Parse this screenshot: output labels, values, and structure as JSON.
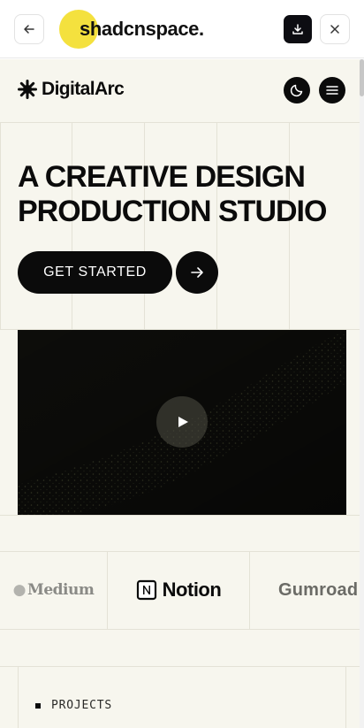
{
  "preview_bar": {
    "brand": "shadcnspace.",
    "back_icon": "arrow-left-icon",
    "download_icon": "download-icon",
    "close_icon": "close-icon"
  },
  "site": {
    "logo_text": "DigitalArc",
    "logo_icon": "starburst-icon",
    "theme_icon": "moon-icon",
    "menu_icon": "hamburger-icon"
  },
  "hero": {
    "title_line1": "A CREATIVE DESIGN",
    "title_line2": "PRODUCTION STUDIO",
    "cta_label": "GET STARTED",
    "cta_icon": "arrow-right-icon"
  },
  "video": {
    "play_icon": "play-icon"
  },
  "partners": {
    "items": [
      "Medium",
      "Notion",
      "Gumroad"
    ]
  },
  "projects": {
    "label": "PROJECTS"
  },
  "colors": {
    "accent_yellow": "#f4e13e",
    "page_bg": "#f7f6ee",
    "ink": "#0b0b0b"
  }
}
